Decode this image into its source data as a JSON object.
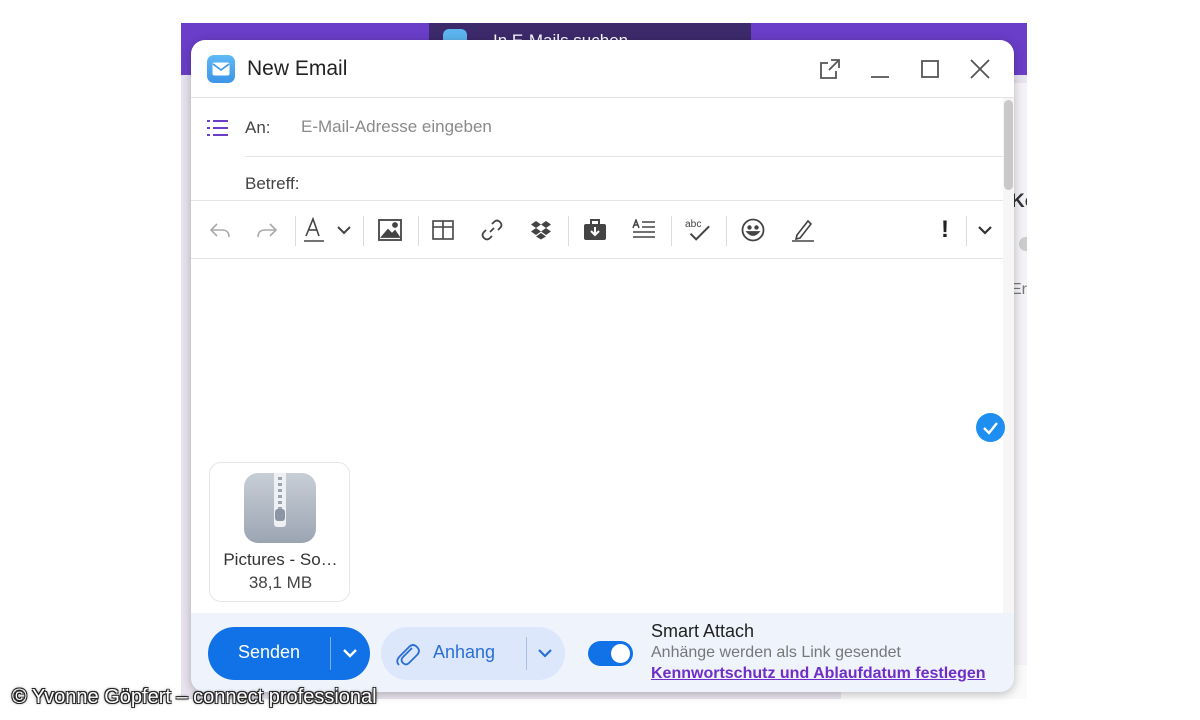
{
  "background": {
    "search_text": "In E-Mails suchen",
    "side_heading": "Ko",
    "side_text": "Eri"
  },
  "dialog": {
    "title": "New Email",
    "icons": [
      "popout-icon",
      "minimize-icon",
      "maximize-icon",
      "close-icon"
    ]
  },
  "to": {
    "label": "An:",
    "placeholder": "E-Mail-Adresse eingeben",
    "value": ""
  },
  "subject": {
    "label": "Betreff:",
    "value": ""
  },
  "toolbar": {
    "tools": [
      "undo-icon",
      "redo-icon",
      "font-color-icon",
      "chevron-down-icon",
      "insert-image-icon",
      "insert-table-icon",
      "insert-link-icon",
      "dropbox-icon",
      "insert-from-cloud-icon",
      "text-format-icon",
      "spellcheck-icon",
      "emoji-icon",
      "signature-icon",
      "priority-icon",
      "more-options-icon"
    ],
    "spellcheck_glyph": "abc",
    "priority_glyph": "!"
  },
  "attachment": {
    "name": "Pictures - So…",
    "size": "38,1 MB",
    "icon": "zip-archive-icon"
  },
  "footer": {
    "send_label": "Senden",
    "attach_label": "Anhang",
    "smart_attach_enabled": true,
    "smart_attach_title": "Smart Attach",
    "smart_attach_subtitle": "Anhänge werden als Link gesendet",
    "smart_attach_link": "Kennwortschutz und Ablaufdatum festlegen"
  },
  "colors": {
    "accent": "#1172e8",
    "header_purple": "#6a3ec9",
    "link_purple": "#6f2ec8",
    "check_blue": "#1e8ef0",
    "footer_bg": "#eef3fc"
  },
  "credit": "© Yvonne Göpfert – connect professional"
}
